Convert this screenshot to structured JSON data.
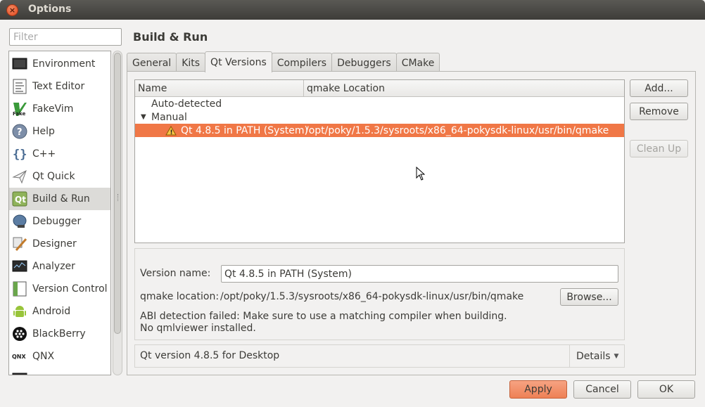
{
  "window": {
    "title": "Options"
  },
  "filter": {
    "placeholder": "Filter"
  },
  "categories": [
    {
      "label": "Environment",
      "icon": "monitor-icon"
    },
    {
      "label": "Text Editor",
      "icon": "text-editor-icon"
    },
    {
      "label": "FakeVim",
      "icon": "fakevim-icon"
    },
    {
      "label": "Help",
      "icon": "help-icon"
    },
    {
      "label": "C++",
      "icon": "cpp-braces-icon"
    },
    {
      "label": "Qt Quick",
      "icon": "qt-quick-icon"
    },
    {
      "label": "Build & Run",
      "icon": "build-run-icon",
      "selected": true
    },
    {
      "label": "Debugger",
      "icon": "debugger-icon"
    },
    {
      "label": "Designer",
      "icon": "designer-icon"
    },
    {
      "label": "Analyzer",
      "icon": "analyzer-icon"
    },
    {
      "label": "Version Control",
      "icon": "version-control-icon"
    },
    {
      "label": "Android",
      "icon": "android-icon"
    },
    {
      "label": "BlackBerry",
      "icon": "blackberry-icon"
    },
    {
      "label": "QNX",
      "icon": "qnx-icon"
    }
  ],
  "page": {
    "title": "Build & Run"
  },
  "tabs": [
    {
      "label": "General"
    },
    {
      "label": "Kits"
    },
    {
      "label": "Qt Versions",
      "active": true
    },
    {
      "label": "Compilers"
    },
    {
      "label": "Debuggers"
    },
    {
      "label": "CMake"
    }
  ],
  "tree": {
    "columns": [
      "Name",
      "qmake Location"
    ],
    "groups": {
      "auto": "Auto-detected",
      "manual": "Manual"
    },
    "selected_row": {
      "name": "Qt 4.8.5 in PATH (System)",
      "location": "/opt/poky/1.5.3/sysroots/x86_64-pokysdk-linux/usr/bin/qmake",
      "icon": "warning-icon"
    }
  },
  "side_buttons": {
    "add": "Add...",
    "remove": "Remove",
    "clean_up": "Clean Up"
  },
  "details": {
    "version_name_label": "Version name:",
    "version_name_value": "Qt 4.8.5 in PATH (System)",
    "qmake_location_label": "qmake location:",
    "qmake_location_value": "/opt/poky/1.5.3/sysroots/x86_64-pokysdk-linux/usr/bin/qmake",
    "browse": "Browse...",
    "warning_line1": "ABI detection failed: Make sure to use a matching compiler when building.",
    "warning_line2": "No qmlviewer installed."
  },
  "summary": {
    "text": "Qt version 4.8.5 for Desktop",
    "details_label": "Details"
  },
  "buttons": {
    "apply": "Apply",
    "cancel": "Cancel",
    "ok": "OK"
  },
  "colors": {
    "accent": "#f07746",
    "title_bar": "#3e3d39",
    "close_button": "#e1481f"
  }
}
